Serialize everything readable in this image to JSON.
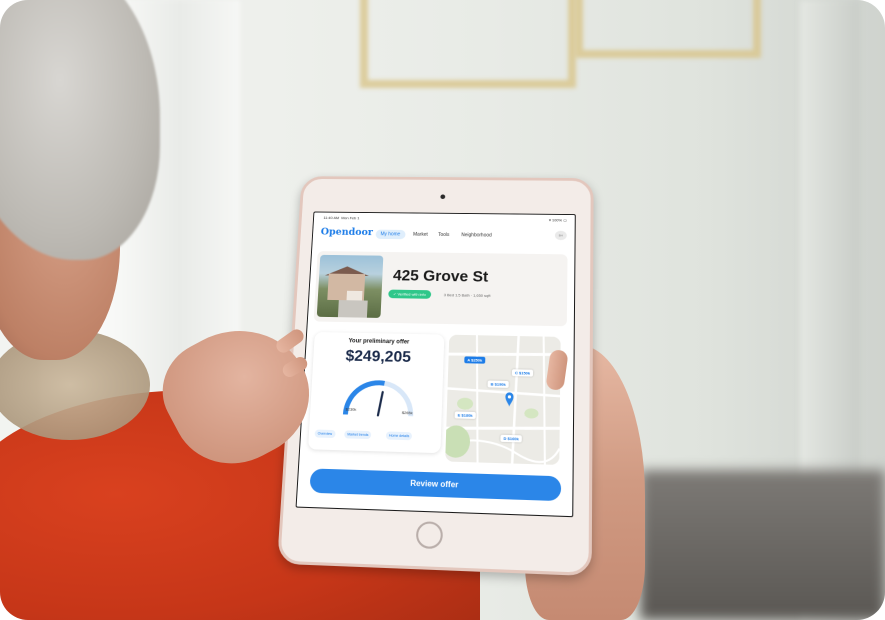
{
  "status_bar": {
    "time": "11:40 AM",
    "date": "Mon Feb 1",
    "battery": "100%"
  },
  "app": {
    "logo": "Opendoor",
    "tabs": [
      {
        "label": "My home",
        "active": true
      },
      {
        "label": "Market",
        "active": false
      },
      {
        "label": "Tools",
        "active": false
      },
      {
        "label": "Neighborhood",
        "active": false
      }
    ],
    "avatar_label": "BH"
  },
  "property": {
    "address": "425 Grove St",
    "badge": "Verified with info",
    "specs": "3 Bed 1.5 Bath · 1,650 sqft"
  },
  "offer": {
    "label": "Your preliminary offer",
    "amount": "$249,205",
    "gauge_min": "$230k",
    "gauge_max": "$265k",
    "gauge_level": 0.55,
    "chips": [
      "Overview",
      "Market trends",
      "Home details"
    ]
  },
  "map": {
    "pins": [
      {
        "id": "A",
        "label": "A  $250k",
        "style": "solid"
      },
      {
        "id": "B",
        "label": "B  $190k",
        "style": "outline"
      },
      {
        "id": "C",
        "label": "C  $150k",
        "style": "outline"
      },
      {
        "id": "E",
        "label": "E  $180k",
        "style": "outline"
      },
      {
        "id": "D",
        "label": "D  $160k",
        "style": "outline"
      }
    ]
  },
  "cta": {
    "label": "Review offer"
  },
  "colors": {
    "accent": "#2b86e8",
    "verified": "#2fc78a",
    "shirt": "#c63618"
  }
}
